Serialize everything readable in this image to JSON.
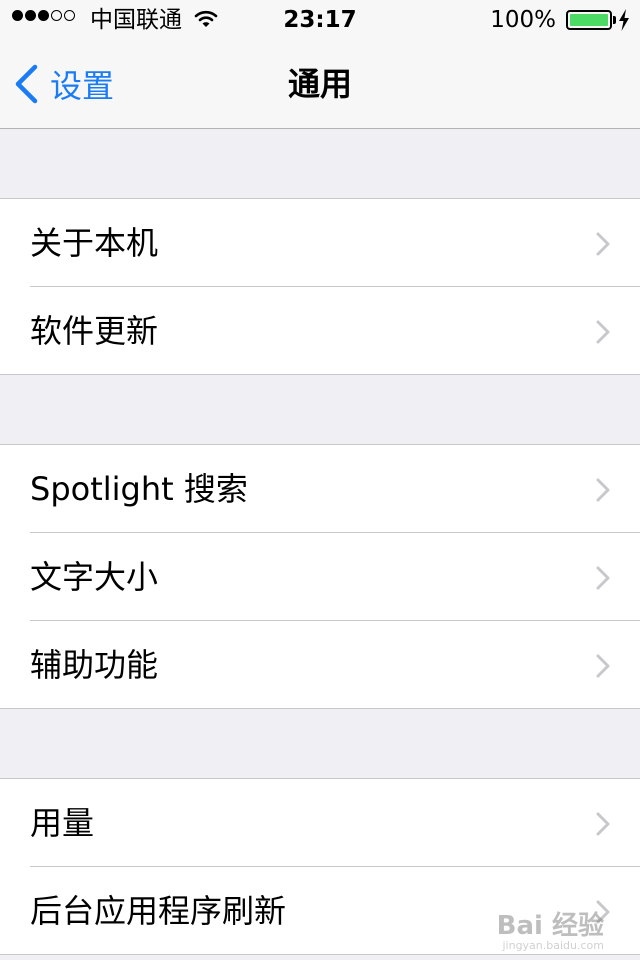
{
  "status_bar": {
    "signal_bars": 5,
    "signal_filled": 3,
    "carrier": "中国联通",
    "time": "23:17",
    "battery_percent": "100%",
    "battery_level": 1.0,
    "battery_color": "#4cd964"
  },
  "navbar": {
    "back_label": "设置",
    "title": "通用",
    "accent_color": "#1a7cf4"
  },
  "groups": [
    {
      "items": [
        {
          "label": "关于本机"
        },
        {
          "label": "软件更新"
        }
      ]
    },
    {
      "items": [
        {
          "label": "Spotlight 搜索"
        },
        {
          "label": "文字大小"
        },
        {
          "label": "辅助功能"
        }
      ]
    },
    {
      "items": [
        {
          "label": "用量"
        },
        {
          "label": "后台应用程序刷新"
        }
      ]
    }
  ],
  "watermark": {
    "text": "Bai 经验",
    "url": "jingyan.baidu.com"
  }
}
